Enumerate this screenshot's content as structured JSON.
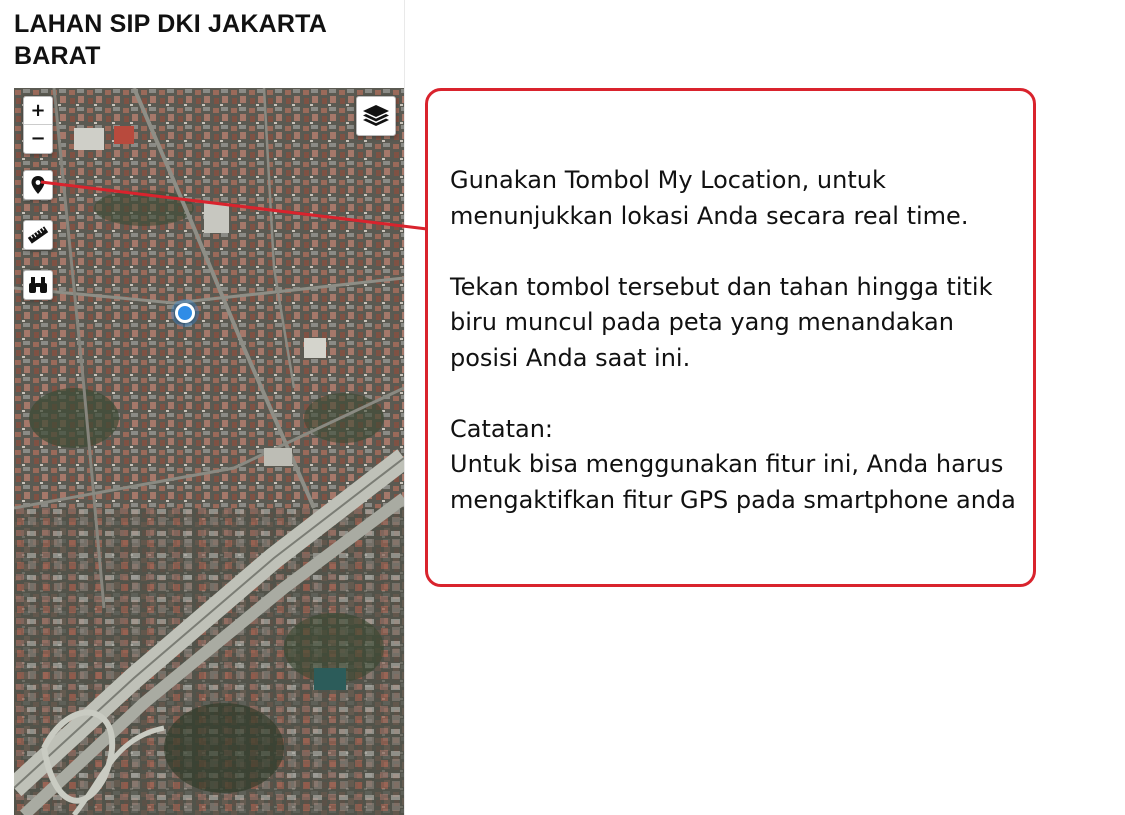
{
  "app": {
    "title": "LAHAN SIP DKI JAKARTA BARAT"
  },
  "map": {
    "zoom_in_label": "+",
    "zoom_out_label": "−",
    "tools": [
      {
        "name": "my-location-button",
        "icon": "location-pin-icon"
      },
      {
        "name": "measure-button",
        "icon": "ruler-icon"
      },
      {
        "name": "binoculars-button",
        "icon": "binoculars-icon"
      }
    ],
    "layers_icon": "layers-icon",
    "user_location_marker": "blue-dot"
  },
  "callout": {
    "paragraph_1": "Gunakan Tombol My Location, untuk menunjukkan lokasi Anda secara real time.",
    "paragraph_2": "Tekan tombol tersebut dan tahan hingga titik biru muncul pada peta yang menandakan posisi Anda saat ini.",
    "note_heading": "Catatan:",
    "note_body": "Untuk bisa menggunakan fitur ini, Anda harus mengaktifkan fitur GPS pada smartphone anda"
  },
  "colors": {
    "callout_border": "#d9232d",
    "connector_line": "#d9232d",
    "location_dot": "#2f8ce6"
  }
}
